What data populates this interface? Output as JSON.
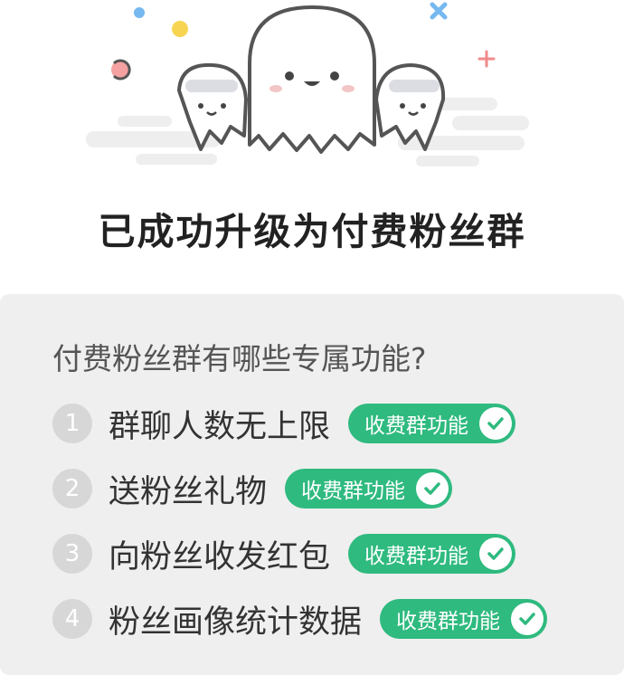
{
  "title": "已成功升级为付费粉丝群",
  "section": {
    "heading": "付费粉丝群有哪些专属功能?",
    "items": [
      {
        "number": "1",
        "label": "群聊人数无上限",
        "badge": "收费群功能"
      },
      {
        "number": "2",
        "label": "送粉丝礼物",
        "badge": "收费群功能"
      },
      {
        "number": "3",
        "label": "向粉丝收发红包",
        "badge": "收费群功能"
      },
      {
        "number": "4",
        "label": "粉丝画像统计数据",
        "badge": "收费群功能"
      }
    ]
  },
  "colors": {
    "badge": "#2fba7f",
    "card_background": "#efefef",
    "number_circle": "#d7d7d7",
    "title": "#222222"
  },
  "icons": [
    "ghost-illustration",
    "check-icon"
  ]
}
